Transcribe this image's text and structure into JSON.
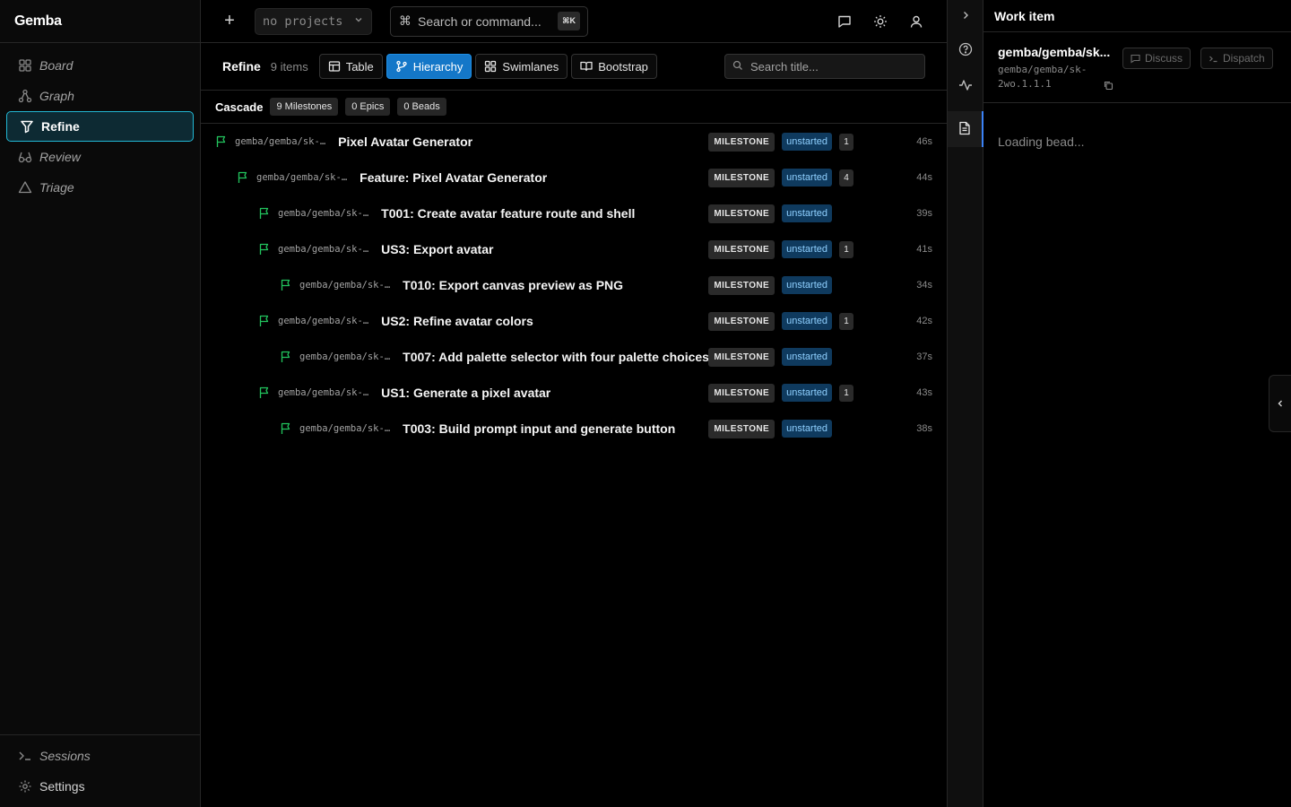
{
  "app": {
    "title": "Gemba"
  },
  "sidebar": {
    "items": [
      {
        "label": "Board",
        "icon": "grid-icon"
      },
      {
        "label": "Graph",
        "icon": "graph-icon"
      },
      {
        "label": "Refine",
        "icon": "filter-icon",
        "active": true
      },
      {
        "label": "Review",
        "icon": "glasses-icon"
      },
      {
        "label": "Triage",
        "icon": "triangle-icon"
      }
    ],
    "bottom": [
      {
        "label": "Sessions",
        "icon": "terminal-icon"
      },
      {
        "label": "Settings",
        "icon": "gear-icon"
      }
    ]
  },
  "topbar": {
    "add": "+",
    "project_select": "no projects",
    "command": {
      "label": "Search or command...",
      "shortcut": "⌘K"
    }
  },
  "toolbar": {
    "title": "Refine",
    "count": "9 items",
    "views": [
      {
        "label": "Table"
      },
      {
        "label": "Hierarchy",
        "active": true
      },
      {
        "label": "Swimlanes"
      },
      {
        "label": "Bootstrap"
      }
    ],
    "search_placeholder": "Search title..."
  },
  "cascade": {
    "label": "Cascade",
    "chips": [
      "9 Milestones",
      "0 Epics",
      "0 Beads"
    ]
  },
  "rows": [
    {
      "id": "gemba/gemba/sk-…",
      "title": "Pixel Avatar Generator",
      "type": "MILESTONE",
      "status": "unstarted",
      "children": "1",
      "age": "46s",
      "depth": 0
    },
    {
      "id": "gemba/gemba/sk-…",
      "title": "Feature: Pixel Avatar Generator",
      "type": "MILESTONE",
      "status": "unstarted",
      "children": "4",
      "age": "44s",
      "depth": 1
    },
    {
      "id": "gemba/gemba/sk-…",
      "title": "T001: Create avatar feature route and shell",
      "type": "MILESTONE",
      "status": "unstarted",
      "children": "",
      "age": "39s",
      "depth": 2
    },
    {
      "id": "gemba/gemba/sk-…",
      "title": "US3: Export avatar",
      "type": "MILESTONE",
      "status": "unstarted",
      "children": "1",
      "age": "41s",
      "depth": 2
    },
    {
      "id": "gemba/gemba/sk-…",
      "title": "T010: Export canvas preview as PNG",
      "type": "MILESTONE",
      "status": "unstarted",
      "children": "",
      "age": "34s",
      "depth": 3
    },
    {
      "id": "gemba/gemba/sk-…",
      "title": "US2: Refine avatar colors",
      "type": "MILESTONE",
      "status": "unstarted",
      "children": "1",
      "age": "42s",
      "depth": 2
    },
    {
      "id": "gemba/gemba/sk-…",
      "title": "T007: Add palette selector with four palette choices",
      "type": "MILESTONE",
      "status": "unstarted",
      "children": "",
      "age": "37s",
      "depth": 3
    },
    {
      "id": "gemba/gemba/sk-…",
      "title": "US1: Generate a pixel avatar",
      "type": "MILESTONE",
      "status": "unstarted",
      "children": "1",
      "age": "43s",
      "depth": 2
    },
    {
      "id": "gemba/gemba/sk-…",
      "title": "T003: Build prompt input and generate button",
      "type": "MILESTONE",
      "status": "unstarted",
      "children": "",
      "age": "38s",
      "depth": 3
    }
  ],
  "panel": {
    "title": "Work item",
    "item_title": "gemba/gemba/sk...",
    "item_id": "gemba/gemba/sk-2wo.1.1.1",
    "discuss": "Discuss",
    "dispatch": "Dispatch",
    "loading": "Loading bead..."
  },
  "colors": {
    "accent": "#22b8d4",
    "active_view": "#1477c8",
    "flag": "#22c55e",
    "status_bg": "#0f3a5e"
  }
}
